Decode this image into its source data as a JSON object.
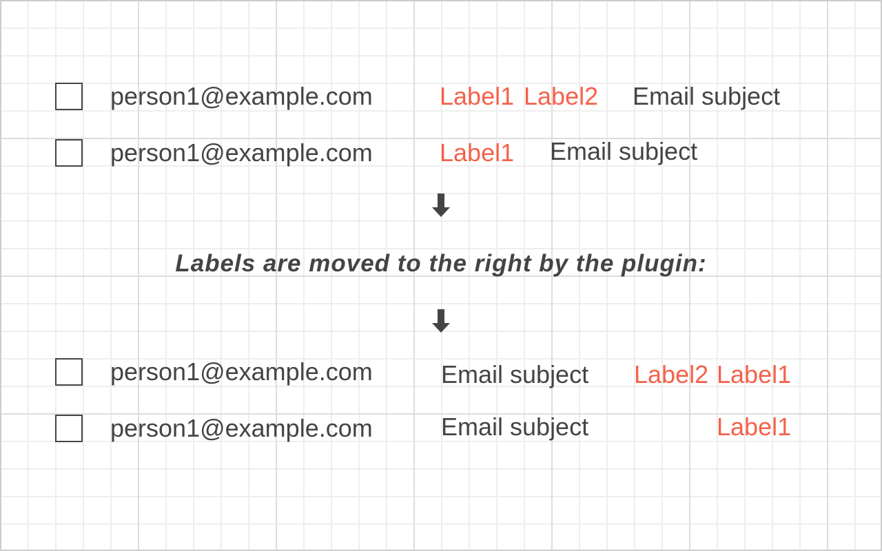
{
  "before": [
    {
      "email": "person1@example.com",
      "labels": [
        "Label1",
        "Label2"
      ],
      "subject": "Email subject"
    },
    {
      "email": "person1@example.com",
      "labels": [
        "Label1"
      ],
      "subject": "Email subject"
    }
  ],
  "caption": "Labels are moved to the right by the plugin:",
  "after": [
    {
      "email": "person1@example.com",
      "subject": "Email subject",
      "labels": [
        "Label2",
        "Label1"
      ]
    },
    {
      "email": "person1@example.com",
      "subject": "Email subject",
      "labels": [
        "Label1"
      ]
    }
  ],
  "colors": {
    "text": "#444444",
    "label": "#f4614a",
    "grid": "#eeeeee"
  }
}
